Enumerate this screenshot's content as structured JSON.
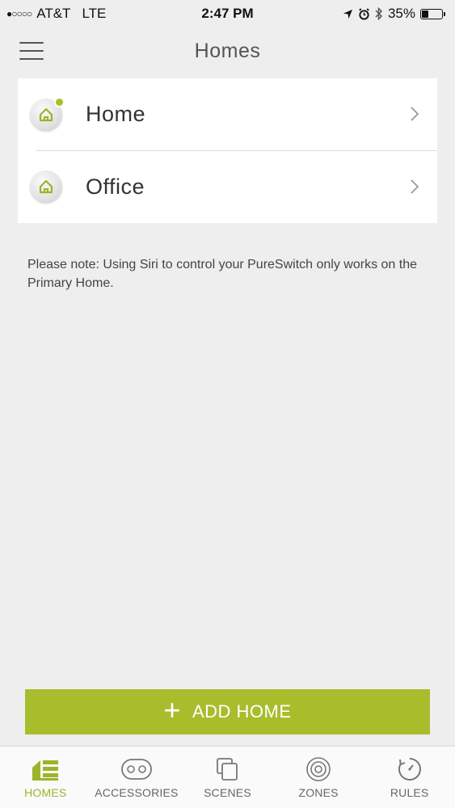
{
  "status": {
    "signal": "●○○○○",
    "carrier": "AT&T",
    "network": "LTE",
    "time": "2:47 PM",
    "battery": "35%"
  },
  "nav": {
    "title": "Homes"
  },
  "homes": [
    {
      "name": "Home",
      "primary": true
    },
    {
      "name": "Office",
      "primary": false
    }
  ],
  "note": "Please note: Using Siri to control your PureSwitch only works on the Primary Home.",
  "add_button": {
    "icon": "+",
    "label": "ADD HOME"
  },
  "tabs": [
    {
      "label": "HOMES",
      "icon": "homes-icon",
      "active": true
    },
    {
      "label": "ACCESSORIES",
      "icon": "accessories-icon",
      "active": false
    },
    {
      "label": "SCENES",
      "icon": "scenes-icon",
      "active": false
    },
    {
      "label": "ZONES",
      "icon": "zones-icon",
      "active": false
    },
    {
      "label": "RULES",
      "icon": "rules-icon",
      "active": false
    }
  ],
  "colors": {
    "accent": "#a8bd2c",
    "active_tab": "#9ab52a",
    "background": "#eeeeee"
  }
}
